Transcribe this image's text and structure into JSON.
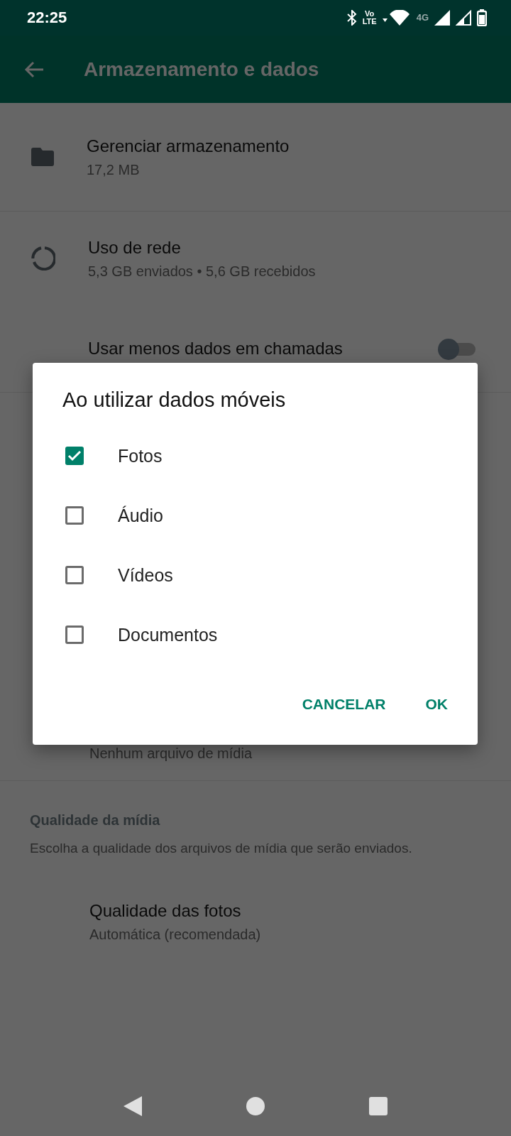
{
  "status_bar": {
    "time": "22:25",
    "volte": [
      "Vo",
      "LTE"
    ],
    "network": "4G"
  },
  "app_bar": {
    "title": "Armazenamento e dados"
  },
  "settings": [
    {
      "kind": "storage",
      "title": "Gerenciar armazenamento",
      "subtitle": "17,2 MB"
    },
    {
      "kind": "network",
      "title": "Uso de rede",
      "subtitle": "5,3 GB enviados • 5,6 GB recebidos"
    },
    {
      "kind": "toggle",
      "title": "Usar menos dados em chamadas",
      "on": false
    }
  ],
  "hidden_row": {
    "subtitle": "Nenhum arquivo de mídia"
  },
  "media_quality": {
    "heading": "Qualidade da mídia",
    "description": "Escolha a qualidade dos arquivos de mídia que serão enviados.",
    "item": {
      "title": "Qualidade das fotos",
      "subtitle": "Automática (recomendada)"
    }
  },
  "dialog": {
    "title": "Ao utilizar dados móveis",
    "options": [
      {
        "label": "Fotos",
        "checked": true
      },
      {
        "label": "Áudio",
        "checked": false
      },
      {
        "label": "Vídeos",
        "checked": false
      },
      {
        "label": "Documentos",
        "checked": false
      }
    ],
    "buttons": [
      "CANCELAR",
      "OK"
    ]
  }
}
